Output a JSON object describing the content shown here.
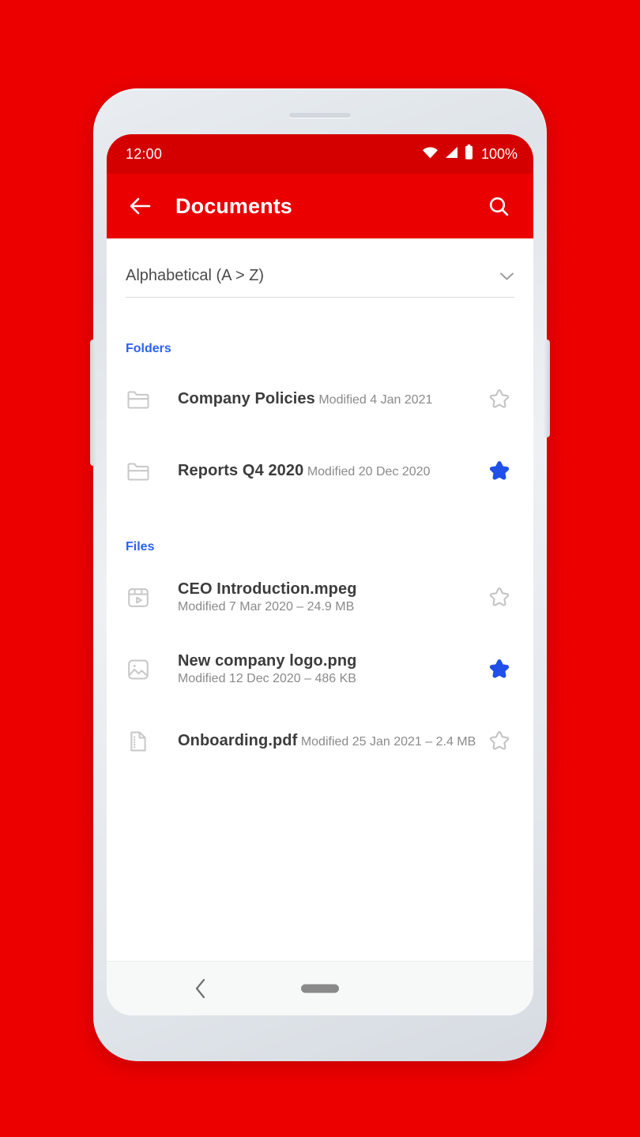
{
  "background_color": "#ED0000",
  "theme": {
    "statusbar_color": "#D40000",
    "appbar_color": "#EA0000",
    "accent_color": "#2962F5",
    "title_color": "#3C3C3C",
    "subtitle_color": "#8A8A8A"
  },
  "status_bar": {
    "time": "12:00",
    "battery_percent": "100%",
    "icons": [
      "wifi-icon",
      "signal-icon",
      "battery-icon"
    ]
  },
  "app_bar": {
    "back_icon": "arrow-left-icon",
    "title": "Documents",
    "search_icon": "search-icon"
  },
  "sort": {
    "value": "Alphabetical (A > Z)",
    "caret_icon": "chevron-down-icon"
  },
  "sections": [
    {
      "heading": "Folders",
      "items": [
        {
          "icon": "folder-icon",
          "title": "Company Policies",
          "subtitle": "Modified 4 Jan 2021",
          "starred": false,
          "star_icon": "star-outline-icon"
        },
        {
          "icon": "folder-icon",
          "title": "Reports Q4 2020",
          "subtitle": "Modified 20 Dec 2020",
          "starred": true,
          "star_icon": "star-filled-icon"
        }
      ]
    },
    {
      "heading": "Files",
      "items": [
        {
          "icon": "video-file-icon",
          "title": "CEO Introduction.mpeg",
          "subtitle": "Modified 7 Mar 2020 – 24.9 MB",
          "starred": false,
          "star_icon": "star-outline-icon"
        },
        {
          "icon": "image-file-icon",
          "title": "New company logo.png",
          "subtitle": "Modified 12 Dec 2020 – 486 KB",
          "starred": true,
          "star_icon": "star-filled-icon"
        },
        {
          "icon": "document-file-icon",
          "title": "Onboarding.pdf",
          "subtitle": "Modified 25 Jan 2021 – 2.4 MB",
          "starred": false,
          "star_icon": "star-outline-icon"
        }
      ]
    }
  ],
  "nav_bar": {
    "back_icon": "chevron-left-icon",
    "home_pill": "home-pill-icon"
  }
}
